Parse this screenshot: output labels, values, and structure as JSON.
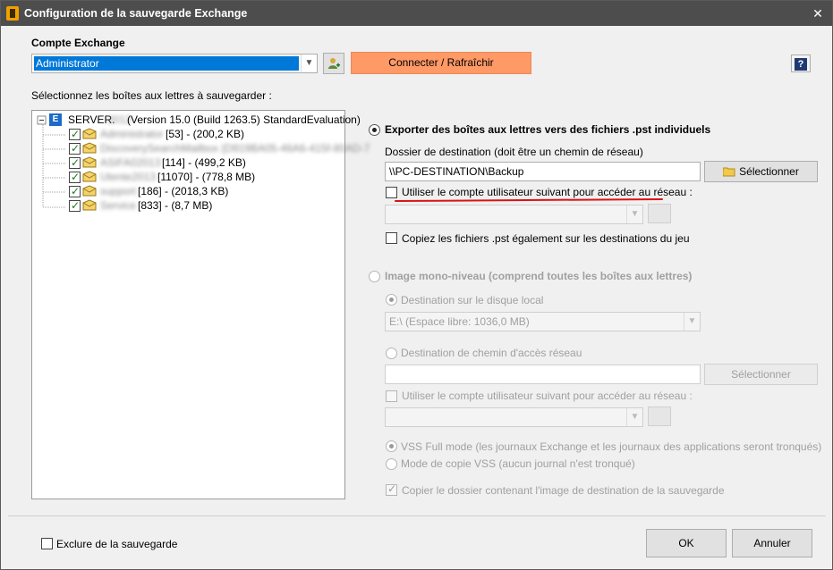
{
  "window": {
    "title": "Configuration de la sauvegarde Exchange",
    "close": "✕"
  },
  "account": {
    "label": "Compte Exchange",
    "selected": "Administrator",
    "connect_button": "Connecter / Rafraîchir",
    "help": "?"
  },
  "mailboxes": {
    "label": "Sélectionnez les boîtes aux lettres à sauvegarder :",
    "server": {
      "name": "SERVER.",
      "name_blurred": "2012",
      "info": "(Version 15.0 (Build 1263.5) StandardEvaluation)"
    },
    "items": [
      {
        "blurred": "Administrator",
        "info": "[53] - (200,2 KB)",
        "checked": true
      },
      {
        "blurred": "DiscoverySearchMailbox {D919BA05-46A6-415f-80AD-7",
        "info": "",
        "checked": true
      },
      {
        "blurred": "ASIFA02013",
        "info": "[114] - (499,2 KB)",
        "checked": true
      },
      {
        "blurred": "Utente2013",
        "info": "[11070] - (778,8 MB)",
        "checked": true
      },
      {
        "blurred": "support",
        "info": "[186] - (2018,3 KB)",
        "checked": true
      },
      {
        "blurred": "Service",
        "info": "[833] - (8,7 MB)",
        "checked": true
      }
    ]
  },
  "export_pst": {
    "option_label": "Exporter des boîtes aux lettres vers des fichiers .pst individuels",
    "selected": true,
    "dest_label": "Dossier de destination (doit être un chemin de réseau)",
    "dest_value": "\\\\PC-DESTINATION\\Backup",
    "select_button": "Sélectionner",
    "use_account_label": "Utiliser le compte utilisateur suivant pour accéder au réseau :",
    "copy_label": "Copiez les fichiers .pst également sur les destinations du jeu"
  },
  "image": {
    "option_label": "Image mono-niveau (comprend toutes les boîtes aux lettres)",
    "local_label": "Destination sur le disque local",
    "local_value": "E:\\   (Espace libre: 1036,0 MB)",
    "network_label": "Destination de chemin d'accès réseau",
    "select_button": "Sélectionner",
    "use_account_label": "Utiliser le compte utilisateur suivant pour accéder au réseau :",
    "vss_full": "VSS Full mode (les journaux Exchange et les journaux des applications seront tronqués)",
    "vss_copy": "Mode de copie VSS (aucun journal n'est tronqué)",
    "copy_folder": "Copier le dossier contenant l'image de destination de la sauvegarde"
  },
  "footer": {
    "exclude": "Exclure de la sauvegarde",
    "ok": "OK",
    "cancel": "Annuler"
  },
  "colors": {
    "connect_button": "#ff9966",
    "title_bar": "#4d4d4d",
    "selection": "#0078d7",
    "underline": "#dd1111"
  }
}
